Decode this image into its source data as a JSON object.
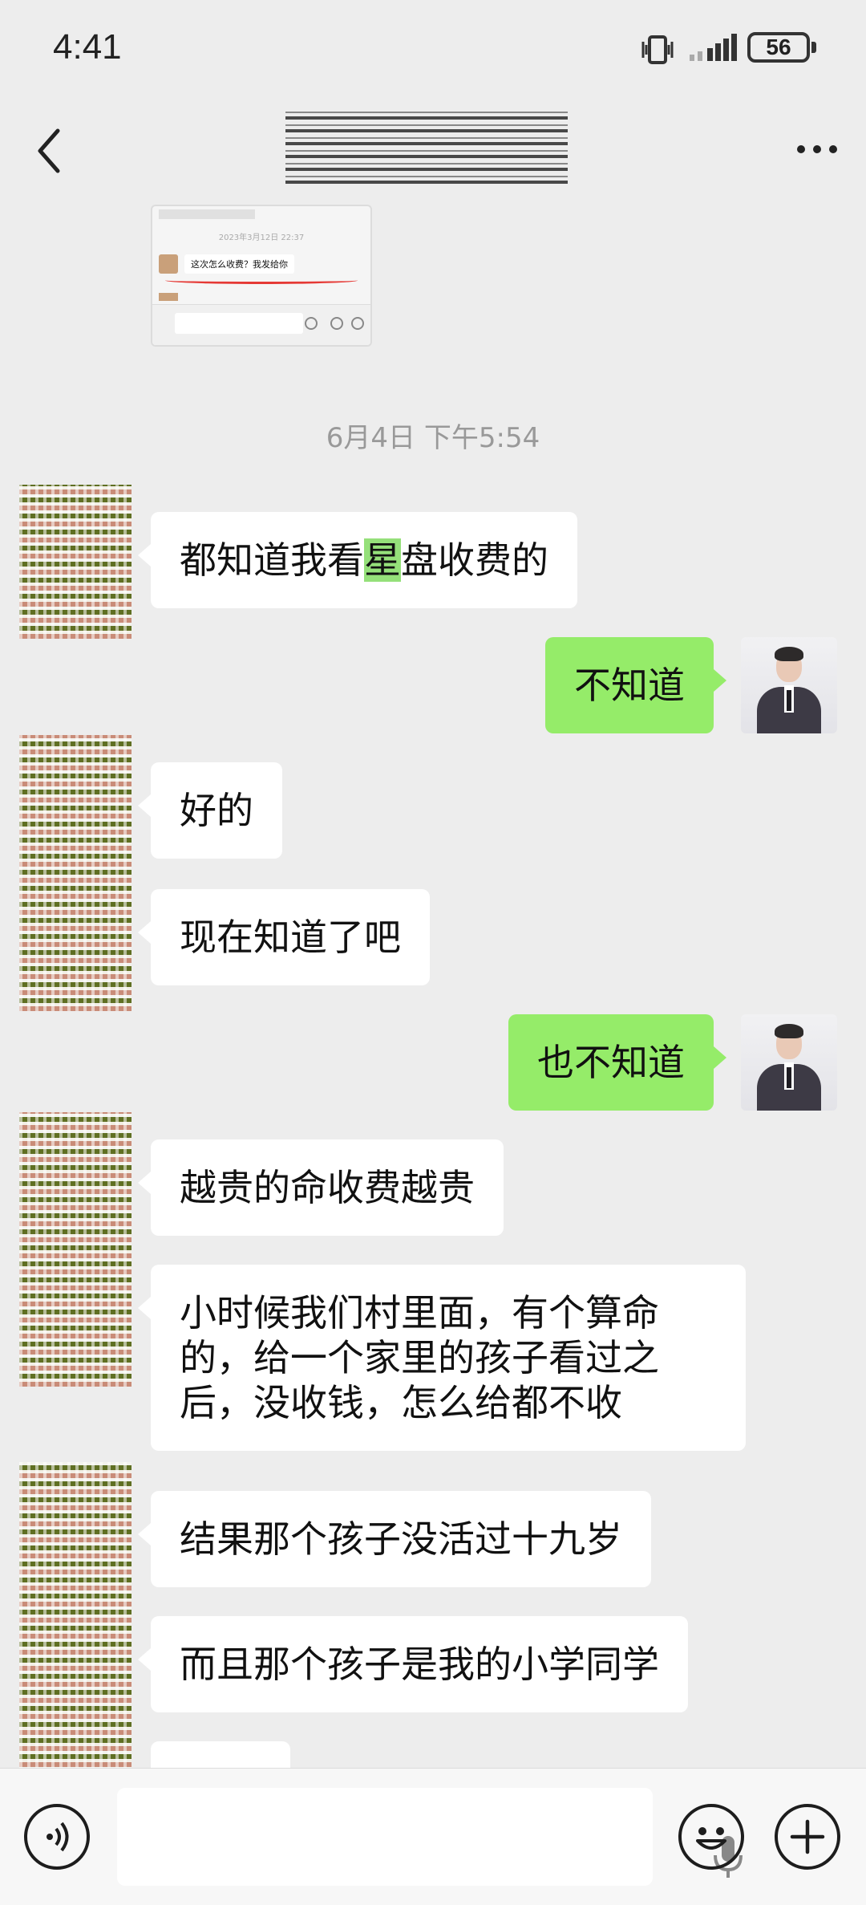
{
  "status_bar": {
    "time": "4:41",
    "battery": "56"
  },
  "header": {
    "contact_name": ""
  },
  "conversation": {
    "timestamp": "6月4日 下午5:54",
    "messages": [
      {
        "side": "left",
        "pre": "都知道我看",
        "hl": "星",
        "post": "盘收费的"
      },
      {
        "side": "right",
        "text": "不知道"
      },
      {
        "side": "left",
        "text": "好的"
      },
      {
        "side": "left",
        "text": "现在知道了吧"
      },
      {
        "side": "right",
        "text": "也不知道"
      },
      {
        "side": "left",
        "text": "越贵的命收费越贵"
      },
      {
        "side": "left",
        "text": "小时候我们村里面，有个算命的，给一个家里的孩子看过之后，没收钱，怎么给都不收"
      },
      {
        "side": "left",
        "text": "结果那个孩子没活过十九岁"
      },
      {
        "side": "left",
        "text": "而且那个孩子是我的小学同学"
      }
    ]
  },
  "thumbnail": {
    "timestamp": "2023年3月12日 22:37",
    "message": "这次怎么收费？我发给你"
  },
  "input_bar": {
    "placeholder": ""
  },
  "colors": {
    "background": "#ededed",
    "sent_bubble": "#95ec69",
    "received_bubble": "#ffffff"
  }
}
